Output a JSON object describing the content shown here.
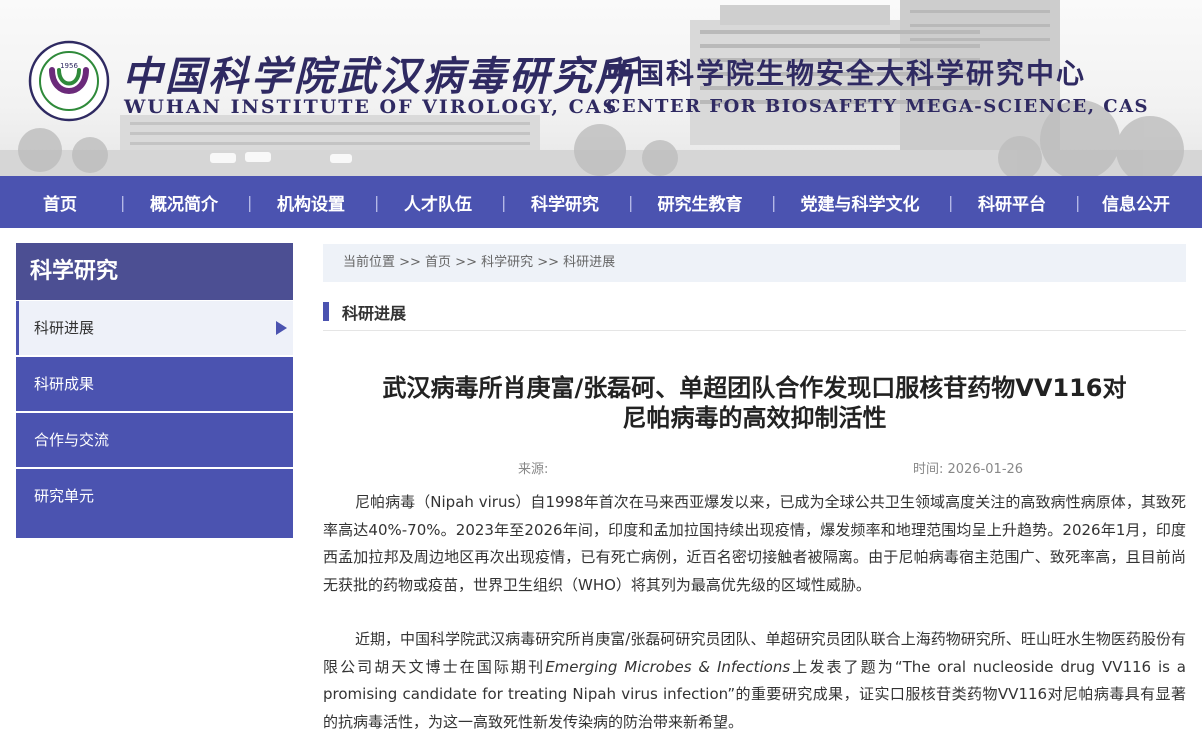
{
  "header": {
    "institute_cn": "中国科学院武汉病毒研究所",
    "institute_en": "WUHAN INSTITUTE OF VIROLOGY, CAS",
    "center_cn": "中国科学院生物安全大科学研究中心",
    "center_en": "CENTER FOR BIOSAFETY MEGA-SCIENCE, CAS",
    "logo_year": "1956"
  },
  "nav": {
    "items": [
      {
        "label": "首页"
      },
      {
        "label": "概况简介"
      },
      {
        "label": "机构设置"
      },
      {
        "label": "人才队伍"
      },
      {
        "label": "科学研究"
      },
      {
        "label": "研究生教育"
      },
      {
        "label": "党建与科学文化"
      },
      {
        "label": "科研平台"
      },
      {
        "label": "信息公开"
      }
    ]
  },
  "sidebar": {
    "title": "科学研究",
    "items": [
      {
        "label": "科研进展"
      },
      {
        "label": "科研成果"
      },
      {
        "label": "合作与交流"
      },
      {
        "label": "研究单元"
      }
    ]
  },
  "breadcrumb": {
    "text": "当前位置 >>  首页 >> 科学研究 >> 科研进展"
  },
  "section": {
    "title": "科研进展"
  },
  "article": {
    "title_line1": "武汉病毒所肖庚富/张磊砢、单超团队合作发现口服核苷药物VV116对",
    "title_line2": "尼帕病毒的高效抑制活性",
    "source_label": "来源:",
    "time_label": "时间: 2026-01-26",
    "p1": "尼帕病毒（Nipah virus）自1998年首次在马来西亚爆发以来，已成为全球公共卫生领域高度关注的高致病性病原体，其致死率高达40%-70%。2023年至2026年间，印度和孟加拉国持续出现疫情，爆发频率和地理范围均呈上升趋势。2026年1月，印度西孟加拉邦及周边地区再次出现疫情，已有死亡病例，近百名密切接触者被隔离。由于尼帕病毒宿主范围广、致死率高，且目前尚无获批的药物或疫苗，世界卫生组织（WHO）将其列为最高优先级的区域性威胁。",
    "p2_a": "近期，中国科学院武汉病毒研究所肖庚富/张磊砢研究员团队、单超研究员团队联合上海药物研究所、旺山旺水生物医药股份有限公司胡天文博士在国际期刊",
    "p2_journal": "Emerging Microbes & Infections",
    "p2_b": "上发表了题为“The oral nucleoside drug VV116 is a promising candidate for treating Nipah virus infection”的重要研究成果，证实口服核苷类药物VV116对尼帕病毒具有显著的抗病毒活性，为这一高致死性新发传染病的防治带来新希望。"
  }
}
